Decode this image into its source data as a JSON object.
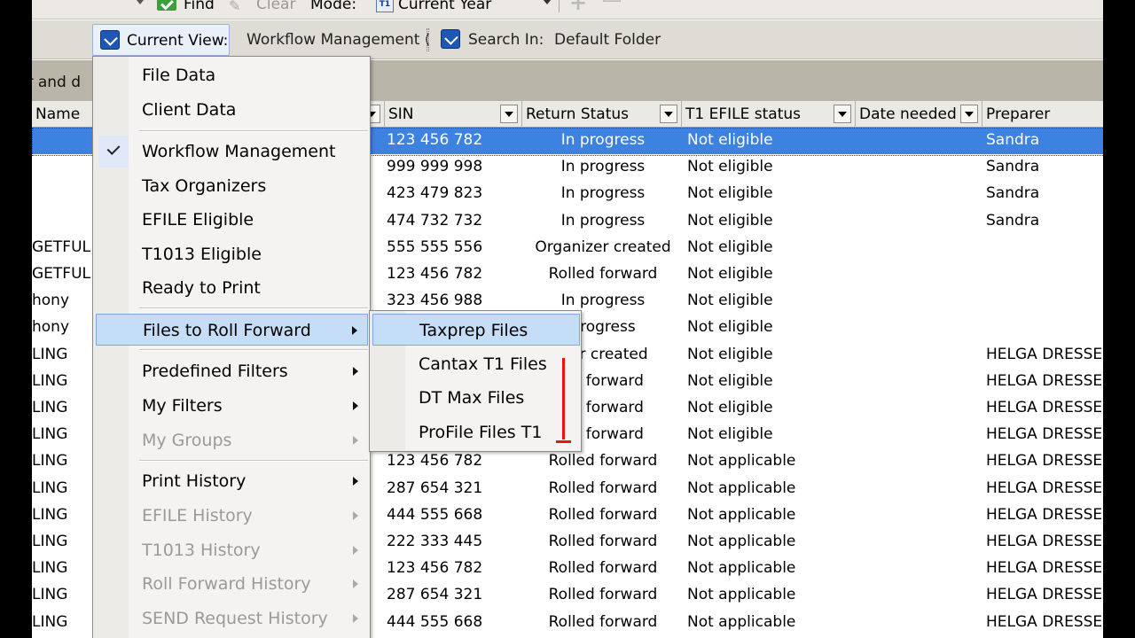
{
  "toolbar": {
    "find_label": "Find",
    "clear_label": "Clear",
    "mode_label": "Mode:",
    "mode_value": "Current Year",
    "calendar_icon_text": "T1"
  },
  "view_bar": {
    "current_view_label": "Current View:",
    "current_view_value": "Workflow Management (",
    "search_in_label": "Search In:",
    "search_in_value": "Default Folder"
  },
  "group_band_text": "er and d",
  "columns": {
    "name": "Name",
    "sin": "SIN",
    "return_status": "Return Status",
    "t1_efile": "T1 EFILE status",
    "date_needed": "Date needed",
    "preparer": "Preparer"
  },
  "rows": [
    {
      "name": "",
      "sin": "123 456 782",
      "status": "In progress",
      "efile": "Not eligible",
      "preparer": "Sandra"
    },
    {
      "name": "",
      "sin": "999 999 998",
      "status": "In progress",
      "efile": "Not eligible",
      "preparer": "Sandra"
    },
    {
      "name": "",
      "sin": "423 479 823",
      "status": "In progress",
      "efile": "Not eligible",
      "preparer": "Sandra"
    },
    {
      "name": "",
      "sin": "474 732 732",
      "status": "In progress",
      "efile": "Not eligible",
      "preparer": "Sandra"
    },
    {
      "name": "GETFUL",
      "sin": "555 555 556",
      "status": "Organizer created",
      "efile": "Not eligible",
      "preparer": ""
    },
    {
      "name": "GETFUL",
      "sin": "123 456 782",
      "status": "Rolled forward",
      "efile": "Not eligible",
      "preparer": ""
    },
    {
      "name": "hony",
      "sin": "323 456 988",
      "status": "In progress",
      "efile": "Not eligible",
      "preparer": ""
    },
    {
      "name": "hony",
      "sin": "",
      "status": "progress",
      "efile": "Not eligible",
      "preparer": ""
    },
    {
      "name": "LING",
      "sin": "",
      "status": "izer created",
      "efile": "Not eligible",
      "preparer": "HELGA DRESSEL"
    },
    {
      "name": "LING",
      "sin": "",
      "status": "ed forward",
      "efile": "Not eligible",
      "preparer": "HELGA DRESSEL"
    },
    {
      "name": "LING",
      "sin": "",
      "status": "ed forward",
      "efile": "Not eligible",
      "preparer": "HELGA DRESSEL"
    },
    {
      "name": "LING",
      "sin": "",
      "status": "ed forward",
      "efile": "Not eligible",
      "preparer": "HELGA DRESSEL"
    },
    {
      "name": "LING",
      "sin": "123 456 782",
      "status": "Rolled forward",
      "efile": "Not applicable",
      "preparer": "HELGA DRESSEL"
    },
    {
      "name": "LING",
      "sin": "287 654 321",
      "status": "Rolled forward",
      "efile": "Not applicable",
      "preparer": "HELGA DRESSEL"
    },
    {
      "name": "LING",
      "sin": "444 555 668",
      "status": "Rolled forward",
      "efile": "Not applicable",
      "preparer": "HELGA DRESSEL"
    },
    {
      "name": "LING",
      "sin": "222 333 445",
      "status": "Rolled forward",
      "efile": "Not applicable",
      "preparer": "HELGA DRESSEL"
    },
    {
      "name": "LING",
      "sin": "123 456 782",
      "status": "Rolled forward",
      "efile": "Not applicable",
      "preparer": "HELGA DRESSEL"
    },
    {
      "name": "LING",
      "sin": "287 654 321",
      "status": "Rolled forward",
      "efile": "Not applicable",
      "preparer": "HELGA DRESSEL"
    },
    {
      "name": "LING",
      "sin": "444 555 668",
      "status": "Rolled forward",
      "efile": "Not applicable",
      "preparer": "HELGA DRESSEL"
    }
  ],
  "menu": {
    "file_data": "File Data",
    "client_data": "Client Data",
    "workflow_management": "Workflow Management",
    "tax_organizers": "Tax Organizers",
    "efile_eligible": "EFILE Eligible",
    "t1013_eligible": "T1013 Eligible",
    "ready_to_print": "Ready to Print",
    "files_to_roll_forward": "Files to Roll Forward",
    "predefined_filters": "Predefined Filters",
    "my_filters": "My Filters",
    "my_groups": "My Groups",
    "print_history": "Print History",
    "efile_history": "EFILE History",
    "t1013_history": "T1013 History",
    "roll_forward_history": "Roll Forward History",
    "send_request_history": "SEND Request History"
  },
  "submenu": {
    "taxprep_files": "Taxprep Files",
    "cantax_files": "Cantax T1 Files",
    "dtmax_files": "DT Max Files",
    "profile_files": "ProFile Files  T1"
  },
  "colors": {
    "selection": "#3d82e0",
    "menu_highlight": "#c5ddf7",
    "annotation": "#ee1111"
  }
}
